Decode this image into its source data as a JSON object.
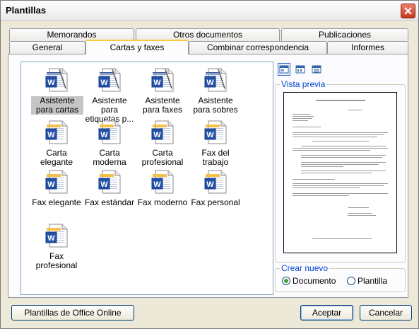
{
  "window": {
    "title": "Plantillas"
  },
  "tabs_back": [
    "Memorandos",
    "Otros documentos",
    "Publicaciones"
  ],
  "tabs_front": [
    "General",
    "Cartas y faxes",
    "Combinar correspondencia",
    "Informes"
  ],
  "active_tab": "Cartas y faxes",
  "templates": [
    {
      "label": "Asistente para cartas",
      "icon": "wizard-doc-icon",
      "selected": true
    },
    {
      "label": "Asistente para etiquetas p...",
      "icon": "wizard-doc-icon"
    },
    {
      "label": "Asistente para faxes",
      "icon": "wizard-doc-icon"
    },
    {
      "label": "Asistente para sobres",
      "icon": "wizard-doc-icon"
    },
    {
      "label": "Carta elegante",
      "icon": "word-doc-icon"
    },
    {
      "label": "Carta moderna",
      "icon": "word-doc-icon"
    },
    {
      "label": "Carta profesional",
      "icon": "word-doc-icon"
    },
    {
      "label": "Fax del trabajo",
      "icon": "word-doc-icon"
    },
    {
      "label": "Fax elegante",
      "icon": "word-doc-icon"
    },
    {
      "label": "Fax estándar",
      "icon": "word-doc-icon"
    },
    {
      "label": "Fax moderno",
      "icon": "word-doc-icon"
    },
    {
      "label": "Fax personal",
      "icon": "word-doc-icon"
    },
    {
      "label": "Fax profesional",
      "icon": "word-doc-icon"
    }
  ],
  "view_buttons": [
    "large-icons-view-icon",
    "list-view-icon",
    "details-view-icon"
  ],
  "preview": {
    "legend": "Vista previa"
  },
  "create_new": {
    "legend": "Crear nuevo",
    "options": [
      "Documento",
      "Plantilla"
    ],
    "selected": "Documento"
  },
  "buttons": {
    "online": "Plantillas de Office Online",
    "ok": "Aceptar",
    "cancel": "Cancelar"
  },
  "colors": {
    "selection": "#c5c5c5",
    "active_tab_accent": "#ffc83c",
    "legend_text": "#0046d5"
  }
}
